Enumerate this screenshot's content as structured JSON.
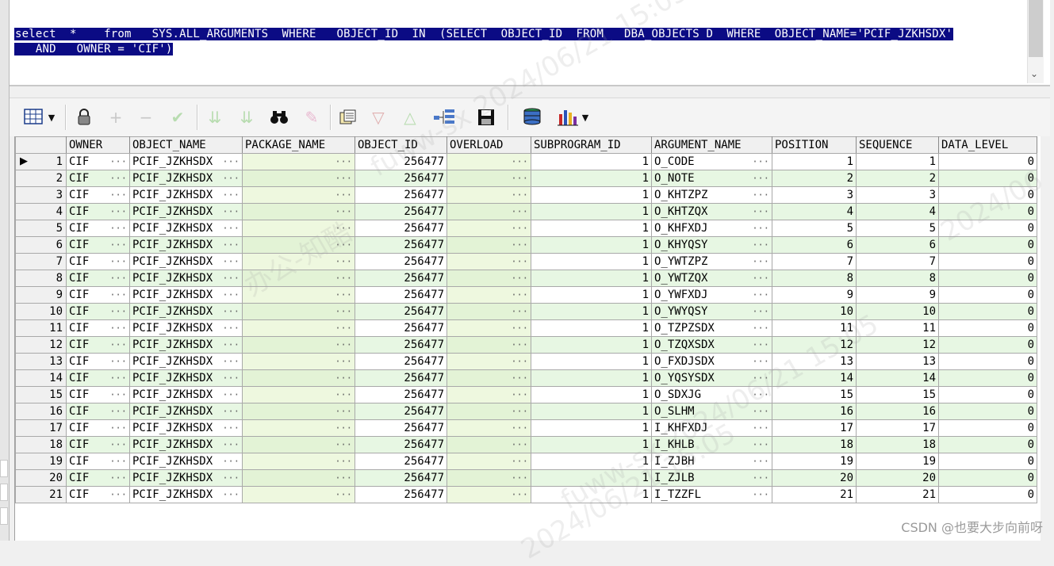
{
  "editor": {
    "sql_line1": "select  *    from   SYS.ALL_ARGUMENTS  WHERE   OBJECT_ID  IN  (SELECT  OBJECT_ID  FROM   DBA_OBJECTS D  WHERE  OBJECT_NAME='PCIF_JZKHSDX'",
    "sql_line2": "   AND   OWNER = 'CIF')"
  },
  "toolbar": {
    "items": [
      {
        "name": "grid-view-icon",
        "glyph": "⊞"
      },
      {
        "name": "lock-icon",
        "glyph": "🔒"
      },
      {
        "name": "add-record-icon",
        "glyph": "+"
      },
      {
        "name": "delete-record-icon",
        "glyph": "−"
      },
      {
        "name": "post-changes-icon",
        "glyph": "✓"
      },
      {
        "name": "filter-down-icon",
        "glyph": "⇊"
      },
      {
        "name": "filter-clear-icon",
        "glyph": "⇊"
      },
      {
        "name": "find-icon",
        "glyph": "🔭"
      },
      {
        "name": "clear-icon",
        "glyph": "✎"
      },
      {
        "name": "export-icon",
        "glyph": "🗎"
      },
      {
        "name": "sort-down-icon",
        "glyph": "▽"
      },
      {
        "name": "sort-up-icon",
        "glyph": "△"
      },
      {
        "name": "query-plan-icon",
        "glyph": "⌘"
      },
      {
        "name": "save-icon",
        "glyph": "💾"
      },
      {
        "name": "database-icon",
        "glyph": "⛁"
      },
      {
        "name": "chart-icon",
        "glyph": "▮"
      }
    ]
  },
  "grid": {
    "columns": [
      "OWNER",
      "OBJECT_NAME",
      "PACKAGE_NAME",
      "OBJECT_ID",
      "OVERLOAD",
      "SUBPROGRAM_ID",
      "ARGUMENT_NAME",
      "POSITION",
      "SEQUENCE",
      "DATA_LEVEL"
    ],
    "rows": [
      {
        "n": "1",
        "owner": "CIF",
        "object_name": "PCIF_JZKHSDX",
        "package_name": "",
        "object_id": "256477",
        "overload": "",
        "subprogram_id": "1",
        "argument_name": "O_CODE",
        "position": "1",
        "sequence": "1",
        "data_level": "0"
      },
      {
        "n": "2",
        "owner": "CIF",
        "object_name": "PCIF_JZKHSDX",
        "package_name": "",
        "object_id": "256477",
        "overload": "",
        "subprogram_id": "1",
        "argument_name": "O_NOTE",
        "position": "2",
        "sequence": "2",
        "data_level": "0"
      },
      {
        "n": "3",
        "owner": "CIF",
        "object_name": "PCIF_JZKHSDX",
        "package_name": "",
        "object_id": "256477",
        "overload": "",
        "subprogram_id": "1",
        "argument_name": "O_KHTZPZ",
        "position": "3",
        "sequence": "3",
        "data_level": "0"
      },
      {
        "n": "4",
        "owner": "CIF",
        "object_name": "PCIF_JZKHSDX",
        "package_name": "",
        "object_id": "256477",
        "overload": "",
        "subprogram_id": "1",
        "argument_name": "O_KHTZQX",
        "position": "4",
        "sequence": "4",
        "data_level": "0"
      },
      {
        "n": "5",
        "owner": "CIF",
        "object_name": "PCIF_JZKHSDX",
        "package_name": "",
        "object_id": "256477",
        "overload": "",
        "subprogram_id": "1",
        "argument_name": "O_KHFXDJ",
        "position": "5",
        "sequence": "5",
        "data_level": "0"
      },
      {
        "n": "6",
        "owner": "CIF",
        "object_name": "PCIF_JZKHSDX",
        "package_name": "",
        "object_id": "256477",
        "overload": "",
        "subprogram_id": "1",
        "argument_name": "O_KHYQSY",
        "position": "6",
        "sequence": "6",
        "data_level": "0"
      },
      {
        "n": "7",
        "owner": "CIF",
        "object_name": "PCIF_JZKHSDX",
        "package_name": "",
        "object_id": "256477",
        "overload": "",
        "subprogram_id": "1",
        "argument_name": "O_YWTZPZ",
        "position": "7",
        "sequence": "7",
        "data_level": "0"
      },
      {
        "n": "8",
        "owner": "CIF",
        "object_name": "PCIF_JZKHSDX",
        "package_name": "",
        "object_id": "256477",
        "overload": "",
        "subprogram_id": "1",
        "argument_name": "O_YWTZQX",
        "position": "8",
        "sequence": "8",
        "data_level": "0"
      },
      {
        "n": "9",
        "owner": "CIF",
        "object_name": "PCIF_JZKHSDX",
        "package_name": "",
        "object_id": "256477",
        "overload": "",
        "subprogram_id": "1",
        "argument_name": "O_YWFXDJ",
        "position": "9",
        "sequence": "9",
        "data_level": "0"
      },
      {
        "n": "10",
        "owner": "CIF",
        "object_name": "PCIF_JZKHSDX",
        "package_name": "",
        "object_id": "256477",
        "overload": "",
        "subprogram_id": "1",
        "argument_name": "O_YWYQSY",
        "position": "10",
        "sequence": "10",
        "data_level": "0"
      },
      {
        "n": "11",
        "owner": "CIF",
        "object_name": "PCIF_JZKHSDX",
        "package_name": "",
        "object_id": "256477",
        "overload": "",
        "subprogram_id": "1",
        "argument_name": "O_TZPZSDX",
        "position": "11",
        "sequence": "11",
        "data_level": "0"
      },
      {
        "n": "12",
        "owner": "CIF",
        "object_name": "PCIF_JZKHSDX",
        "package_name": "",
        "object_id": "256477",
        "overload": "",
        "subprogram_id": "1",
        "argument_name": "O_TZQXSDX",
        "position": "12",
        "sequence": "12",
        "data_level": "0"
      },
      {
        "n": "13",
        "owner": "CIF",
        "object_name": "PCIF_JZKHSDX",
        "package_name": "",
        "object_id": "256477",
        "overload": "",
        "subprogram_id": "1",
        "argument_name": "O_FXDJSDX",
        "position": "13",
        "sequence": "13",
        "data_level": "0"
      },
      {
        "n": "14",
        "owner": "CIF",
        "object_name": "PCIF_JZKHSDX",
        "package_name": "",
        "object_id": "256477",
        "overload": "",
        "subprogram_id": "1",
        "argument_name": "O_YQSYSDX",
        "position": "14",
        "sequence": "14",
        "data_level": "0"
      },
      {
        "n": "15",
        "owner": "CIF",
        "object_name": "PCIF_JZKHSDX",
        "package_name": "",
        "object_id": "256477",
        "overload": "",
        "subprogram_id": "1",
        "argument_name": "O_SDXJG",
        "position": "15",
        "sequence": "15",
        "data_level": "0"
      },
      {
        "n": "16",
        "owner": "CIF",
        "object_name": "PCIF_JZKHSDX",
        "package_name": "",
        "object_id": "256477",
        "overload": "",
        "subprogram_id": "1",
        "argument_name": "O_SLHM",
        "position": "16",
        "sequence": "16",
        "data_level": "0"
      },
      {
        "n": "17",
        "owner": "CIF",
        "object_name": "PCIF_JZKHSDX",
        "package_name": "",
        "object_id": "256477",
        "overload": "",
        "subprogram_id": "1",
        "argument_name": "I_KHFXDJ",
        "position": "17",
        "sequence": "17",
        "data_level": "0"
      },
      {
        "n": "18",
        "owner": "CIF",
        "object_name": "PCIF_JZKHSDX",
        "package_name": "",
        "object_id": "256477",
        "overload": "",
        "subprogram_id": "1",
        "argument_name": "I_KHLB",
        "position": "18",
        "sequence": "18",
        "data_level": "0"
      },
      {
        "n": "19",
        "owner": "CIF",
        "object_name": "PCIF_JZKHSDX",
        "package_name": "",
        "object_id": "256477",
        "overload": "",
        "subprogram_id": "1",
        "argument_name": "I_ZJBH",
        "position": "19",
        "sequence": "19",
        "data_level": "0"
      },
      {
        "n": "20",
        "owner": "CIF",
        "object_name": "PCIF_JZKHSDX",
        "package_name": "",
        "object_id": "256477",
        "overload": "",
        "subprogram_id": "1",
        "argument_name": "I_ZJLB",
        "position": "20",
        "sequence": "20",
        "data_level": "0"
      },
      {
        "n": "21",
        "owner": "CIF",
        "object_name": "PCIF_JZKHSDX",
        "package_name": "",
        "object_id": "256477",
        "overload": "",
        "subprogram_id": "1",
        "argument_name": "I_TZZFL",
        "position": "21",
        "sequence": "21",
        "data_level": "0"
      }
    ],
    "ellipsis": "···",
    "current_row_marker": "▶"
  },
  "watermark": {
    "lines": [
      "fuww-sx 2024/06/21 15:05",
      "办公-知酷",
      "2024/06/21 15:05",
      "fuww-sx 2024/06/21 15:05",
      "2024/06"
    ]
  },
  "footer": {
    "credit": "CSDN @也要大步向前呀"
  },
  "colors": {
    "selection": "#0b0b84",
    "row_alt": "#e7f7e3",
    "header_bg": "#f0f0f0"
  }
}
